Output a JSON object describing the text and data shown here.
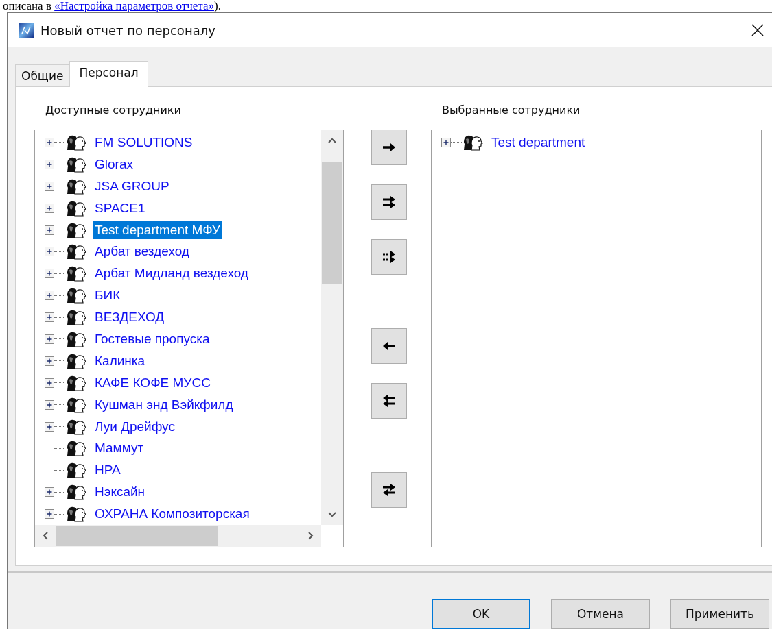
{
  "document_text": {
    "before": "описана в ",
    "link": "«Настройка параметров отчета»",
    "after": ")."
  },
  "window": {
    "title": "Новый отчет по персоналу"
  },
  "tabs": [
    {
      "label": "Общие",
      "selected": false
    },
    {
      "label": "Персонал",
      "selected": true
    }
  ],
  "available": {
    "label": "Доступные сотрудники",
    "items": [
      {
        "label": "FM SOLUTIONS",
        "kind": "group",
        "selected": false
      },
      {
        "label": "Glorax",
        "kind": "group",
        "selected": false
      },
      {
        "label": "JSA GROUP",
        "kind": "group",
        "selected": false
      },
      {
        "label": "SPACE1",
        "kind": "group",
        "selected": false
      },
      {
        "label": "Test department МФУ",
        "kind": "group",
        "selected": true
      },
      {
        "label": "Арбат вездеход",
        "kind": "group",
        "selected": false
      },
      {
        "label": "Арбат Мидланд вездеход",
        "kind": "group",
        "selected": false
      },
      {
        "label": "БИК",
        "kind": "group",
        "selected": false
      },
      {
        "label": "ВЕЗДЕХОД",
        "kind": "group",
        "selected": false
      },
      {
        "label": "Гостевые пропуска",
        "kind": "group",
        "selected": false
      },
      {
        "label": "Калинка",
        "kind": "group",
        "selected": false
      },
      {
        "label": "КАФЕ КОФЕ МУСС",
        "kind": "group",
        "selected": false
      },
      {
        "label": "Кушман энд Вэйкфилд",
        "kind": "group",
        "selected": false
      },
      {
        "label": "Луи Дрейфус",
        "kind": "group",
        "selected": false
      },
      {
        "label": "Маммут",
        "kind": "leaf",
        "selected": false
      },
      {
        "label": "НРА",
        "kind": "leaf",
        "selected": false
      },
      {
        "label": "Нэксайн",
        "kind": "group",
        "selected": false
      },
      {
        "label": "ОХРАНА Композиторская",
        "kind": "group",
        "selected": false
      }
    ]
  },
  "move_buttons": [
    {
      "kind": "add"
    },
    {
      "kind": "add-all"
    },
    {
      "kind": "add-filtered"
    },
    {
      "kind": "remove"
    },
    {
      "kind": "remove-all"
    },
    {
      "kind": "swap"
    }
  ],
  "chosen": {
    "label": "Выбранные сотрудники",
    "items": [
      {
        "label": "Test department",
        "kind": "group",
        "selected": false
      }
    ]
  },
  "buttons": [
    {
      "label": "OK",
      "focused": true
    },
    {
      "label": "Отмена",
      "focused": false
    },
    {
      "label": "Применить",
      "focused": false
    }
  ]
}
